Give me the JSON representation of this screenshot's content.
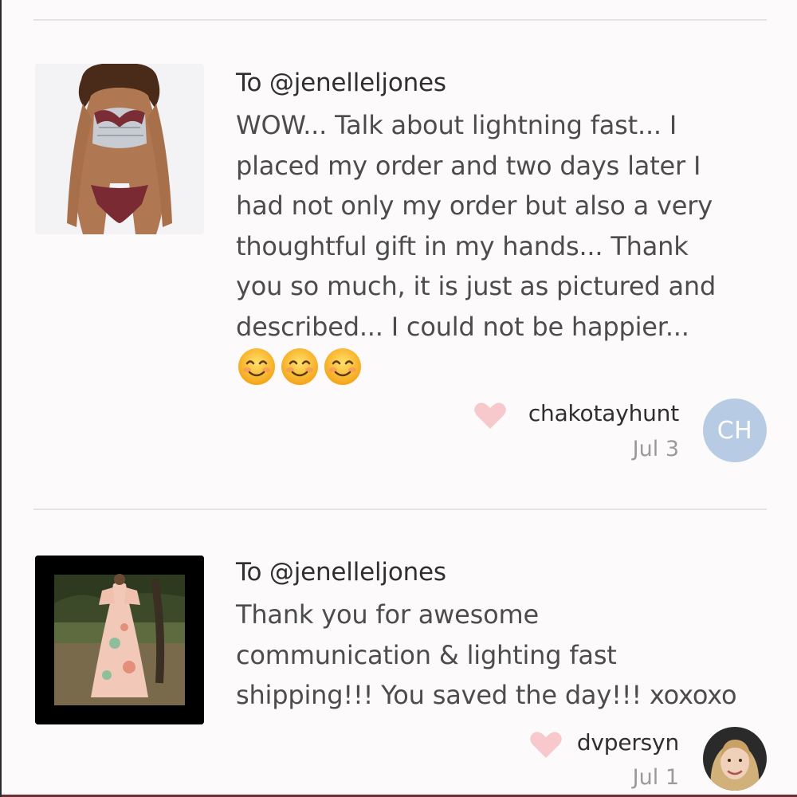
{
  "theme": {
    "heart_color": "#f7c9cc",
    "avatar_ch_color": "#b7cce4",
    "divider_color": "#e6e1e3"
  },
  "reviews": [
    {
      "to": "To @jenelleljones",
      "message_lines": [
        "WOW... Talk about lightning fast... I",
        "placed my order and two days later I",
        "had not only my order but also a very",
        "thoughtful gift in my hands... Thank",
        "you so much, it is just as pictured and",
        "described... I could not be happier..."
      ],
      "emojis": [
        "smiling-face-emoji",
        "smiling-face-emoji",
        "smiling-face-emoji"
      ],
      "thumbnail_icon": "bikini-product-photo",
      "username": "chakotayhunt",
      "date": "Jul 3",
      "avatar_initials": "CH"
    },
    {
      "to": "To @jenelleljones",
      "message_lines": [
        "Thank you for awesome",
        "communication & lighting fast",
        "shipping!!! You saved the day!!! xoxoxo"
      ],
      "thumbnail_icon": "floral-dress-product-photo",
      "username": "dvpersyn",
      "date": "Jul 1",
      "avatar_icon": "user-photo-avatar"
    }
  ]
}
